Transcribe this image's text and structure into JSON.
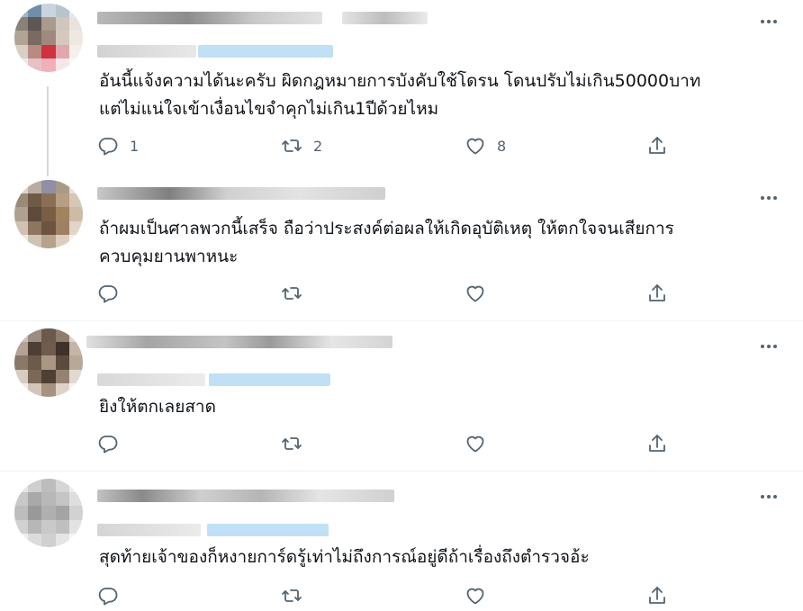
{
  "colors": {
    "text": "#0f1419",
    "secondary": "#536471",
    "divider": "#eff3f4",
    "thread": "#cfd9de",
    "blur_link": "#bfe0f5"
  },
  "icons": {
    "reply": "reply-icon",
    "retweet": "retweet-icon",
    "like": "heart-icon",
    "share": "share-icon",
    "more": "more-icon"
  },
  "tweets": [
    {
      "text": "อันนี้แจ้งความได้นะครับ ผิดกฎหมายการบังคับใช้โดรน โดนปรับไม่เกิน50000บาท\nแต่ไม่แน่ใจเข้าเงื่อนไขจำคุกไม่เกิน1ปีด้วยไหม",
      "reply_count": "1",
      "retweet_count": "2",
      "like_count": "8"
    },
    {
      "text": "ถ้าผมเป็นศาลพวกนี้เสร็จ ถือว่าประสงค์ต่อผลให้เกิดอุบัติเหตุ ให้ตกใจจนเสียการ\nควบคุมยานพาหนะ",
      "reply_count": "",
      "retweet_count": "",
      "like_count": ""
    },
    {
      "text": "ยิงให้ตกเลยสาด",
      "reply_count": "",
      "retweet_count": "",
      "like_count": ""
    },
    {
      "text": "สุดท้ายเจ้าของก็หงายการ์ดรู้เท่าไม่ถึงการณ์อยู่ดีถ้าเรื่องถึงตำรวจอ้ะ",
      "reply_count": "",
      "retweet_count": "",
      "like_count": ""
    }
  ]
}
